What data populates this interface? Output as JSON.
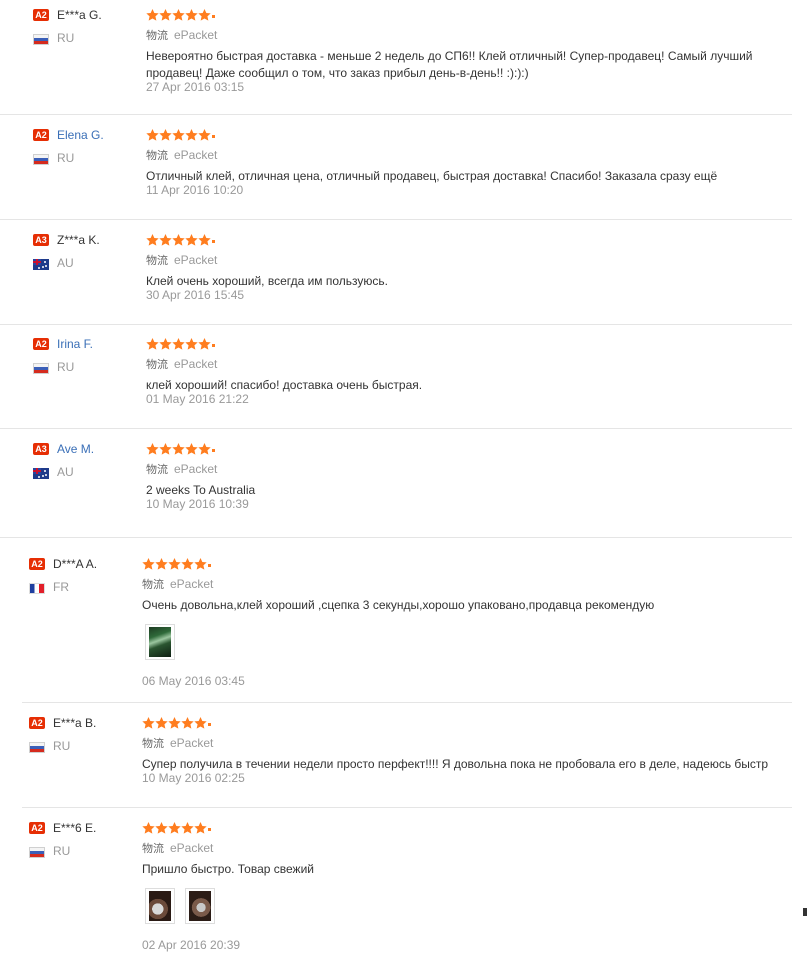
{
  "ship_label_cn": "物流",
  "ship_method": "ePacket",
  "colors": {
    "star": "#ff7d1f",
    "badge": "#e62e04",
    "link": "#3a6fb7",
    "muted": "#999999"
  },
  "reviews": [
    {
      "badge": "A2",
      "name": "E***a G.",
      "name_style": "plain",
      "country": "RU",
      "flag": "ru-flag-icon",
      "rating": 5,
      "text": [
        "Невероятно быстрая доставка - меньше 2 недель до СП6!! Клей отличный! Супер-продавец! Самый лучший",
        "продавец! Даже сообщил о том, что заказ прибыл день-в-день!! :):):)"
      ],
      "date": "27 Apr 2016 03:15",
      "images": 0
    },
    {
      "badge": "A2",
      "name": "Elena G.",
      "name_style": "link",
      "country": "RU",
      "flag": "ru-flag-icon",
      "rating": 5,
      "text": [
        "Отличный клей, отличная цена, отличный продавец, быстрая доставка! Спасибо! Заказала сразу ещё"
      ],
      "date": "11 Apr 2016 10:20",
      "images": 0
    },
    {
      "badge": "A3",
      "name": "Z***a K.",
      "name_style": "plain",
      "country": "AU",
      "flag": "au-flag-icon",
      "rating": 5,
      "text": [
        "Клей очень хороший, всегда им пользуюсь."
      ],
      "date": "30 Apr 2016 15:45",
      "images": 0
    },
    {
      "badge": "A2",
      "name": "Irina F.",
      "name_style": "link",
      "country": "RU",
      "flag": "ru-flag-icon",
      "rating": 5,
      "text": [
        "клей хороший! спасибо! доставка очень быстрая."
      ],
      "date": "01 May 2016 21:22",
      "images": 0
    },
    {
      "badge": "A3",
      "name": "Ave M.",
      "name_style": "link",
      "country": "AU",
      "flag": "au-flag-icon",
      "rating": 5,
      "text": [
        "2 weeks To Australia"
      ],
      "date": "10 May 2016 10:39",
      "images": 0
    },
    {
      "badge": "A2",
      "name": "D***A A.",
      "name_style": "plain",
      "country": "FR",
      "flag": "fr-flag-icon",
      "rating": 5,
      "text": [
        "Очень довольна,клей хороший ,сцепка 3 секунды,хорошо упаковано,продавца рекомендую"
      ],
      "date": "06 May 2016 03:45",
      "images": 1
    },
    {
      "badge": "A2",
      "name": "E***a B.",
      "name_style": "plain",
      "country": "RU",
      "flag": "ru-flag-icon",
      "rating": 5,
      "text": [
        "Супер получила в течении недели просто перфект!!!! Я довольна пока не пробовала его в деле, надеюсь быстр"
      ],
      "date": "10 May 2016 02:25",
      "images": 0
    },
    {
      "badge": "A2",
      "name": "E***6 E.",
      "name_style": "plain",
      "country": "RU",
      "flag": "ru-flag-icon",
      "rating": 5,
      "text": [
        "Пришло быстро. Товар свежий"
      ],
      "date": "02 Apr 2016 20:39",
      "images": 2
    }
  ]
}
